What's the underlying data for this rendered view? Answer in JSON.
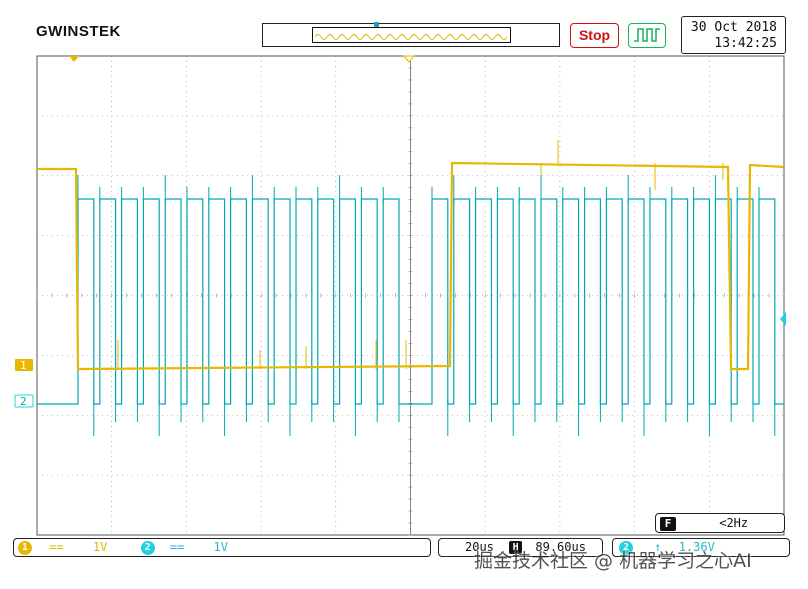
{
  "header": {
    "brand": "GWINSTEK",
    "run_state": "Stop",
    "trigger_mode_icon": "edge-trigger-icon",
    "date": "30 Oct 2018",
    "time": "13:42:25"
  },
  "colors": {
    "ch1": "#e6b800",
    "ch2": "#00a7b5",
    "ch2_light": "#22d0e0",
    "grid": "#888888",
    "stop": "#cc1111",
    "trigger_mode": "#19b25a"
  },
  "markers": {
    "ch1_label": "1",
    "ch2_label": "2"
  },
  "channel_status": {
    "ch1_num": "1",
    "ch1_coupling": "==",
    "ch1_scale": "1V",
    "ch2_num": "2",
    "ch2_coupling": "==",
    "ch2_scale": "1V"
  },
  "timebase": {
    "scale": "20us",
    "h_icon": "H",
    "position": "89.60us"
  },
  "trigger": {
    "source": "2",
    "slope_icon": "rising-edge-icon",
    "level": "1.36V",
    "freq_icon": "F",
    "frequency": "<2Hz"
  },
  "watermark": "掘金技术社区 @ 机器学习之心AI"
}
